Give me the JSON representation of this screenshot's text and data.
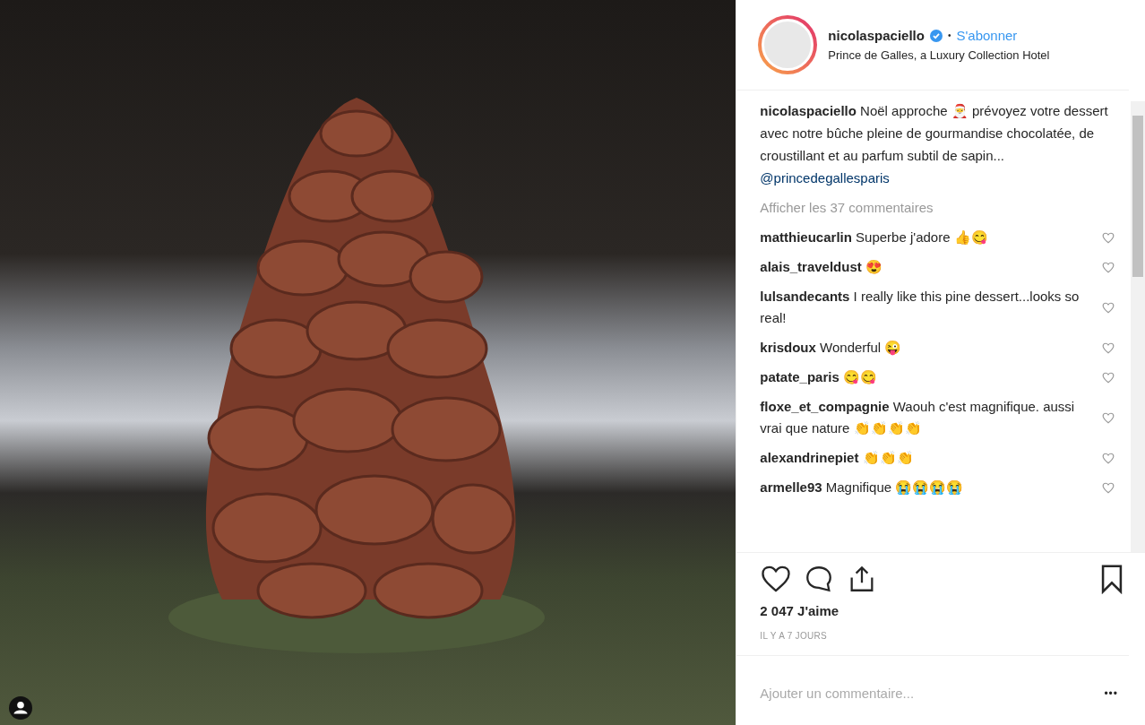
{
  "post": {
    "username": "nicolaspaciello",
    "follow_label": "S'abonner",
    "separator": "•",
    "location": "Prince de Galles, a Luxury Collection Hotel"
  },
  "caption": {
    "username": "nicolaspaciello",
    "text": "Noël approche 🎅 prévoyez votre dessert avec notre bûche pleine de gourmandise chocolatée, de croustillant et au parfum subtil de sapin...",
    "mention": "@princedegallesparis"
  },
  "view_all": "Afficher les 37 commentaires",
  "comments": [
    {
      "username": "matthieucarlin",
      "text": "Superbe j'adore 👍😋",
      "liked": false
    },
    {
      "username": "alais_traveldust",
      "text": "😍",
      "liked": false
    },
    {
      "username": "lulsandecants",
      "text": "I really like this pine dessert...looks so real!",
      "liked": false
    },
    {
      "username": "krisdoux",
      "text": "Wonderful 😜",
      "liked": false
    },
    {
      "username": "patate_paris",
      "text": "😋😋",
      "liked": false
    },
    {
      "username": "floxe_et_compagnie",
      "text": "Waouh c'est magnifique. aussi vrai que nature 👏👏👏👏",
      "liked": false
    },
    {
      "username": "alexandrinepiet",
      "text": "👏👏👏",
      "liked": false
    },
    {
      "username": "armelle93",
      "text": "Magnifique 😭😭😭😭",
      "liked": false
    }
  ],
  "likes": "2 047 J'aime",
  "time": "IL Y A 7 JOURS",
  "add_comment": {
    "placeholder": "Ajouter un commentaire..."
  },
  "more": "•••"
}
